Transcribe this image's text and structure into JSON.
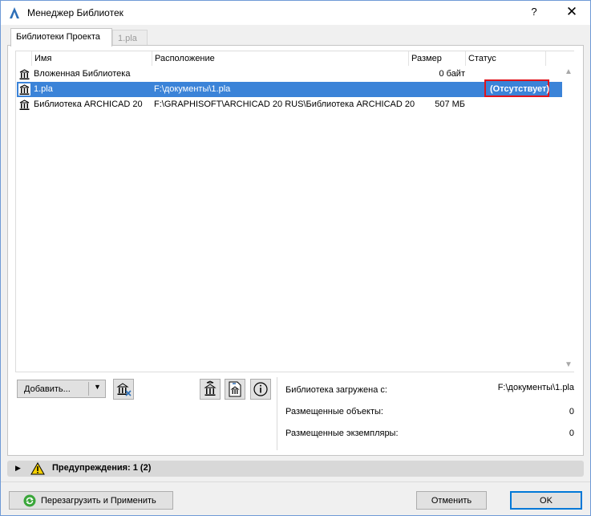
{
  "window": {
    "title": "Менеджер Библиотек",
    "help_label": "?",
    "close_label": "✕"
  },
  "tabs": [
    {
      "label": "Библиотеки Проекта",
      "active": true
    },
    {
      "label": "1.pla",
      "active": false
    }
  ],
  "columns": {
    "name": "Имя",
    "location": "Расположение",
    "size": "Размер",
    "status": "Статус"
  },
  "rows": [
    {
      "name": "Вложенная Библиотека",
      "location": "",
      "size": "0 байт",
      "status": ""
    },
    {
      "name": "1.pla",
      "location": "F:\\документы\\1.pla",
      "size": "",
      "status": "(Отсутствует)"
    },
    {
      "name": "Библиотека ARCHICAD 20",
      "location": "F:\\GRAPHISOFT\\ARCHICAD 20 RUS\\Библиотека ARCHICAD 20",
      "size": "507 МБ",
      "status": ""
    }
  ],
  "toolbar": {
    "add_label": "Добавить..."
  },
  "info": {
    "loaded_from_label": "Библиотека загружена с:",
    "loaded_from_value": "F:\\документы\\1.pla",
    "placed_objects_label": "Размещенные объекты:",
    "placed_objects_value": "0",
    "placed_instances_label": "Размещенные экземпляры:",
    "placed_instances_value": "0"
  },
  "warnings": {
    "label": "Предупреждения: 1 (2)"
  },
  "footer": {
    "reload_label": "Перезагрузить и Применить",
    "cancel_label": "Отменить",
    "ok_label": "OK"
  },
  "colors": {
    "selection": "#3b83d8",
    "missing_highlight": "#e0141c",
    "accent": "#0078d7"
  }
}
